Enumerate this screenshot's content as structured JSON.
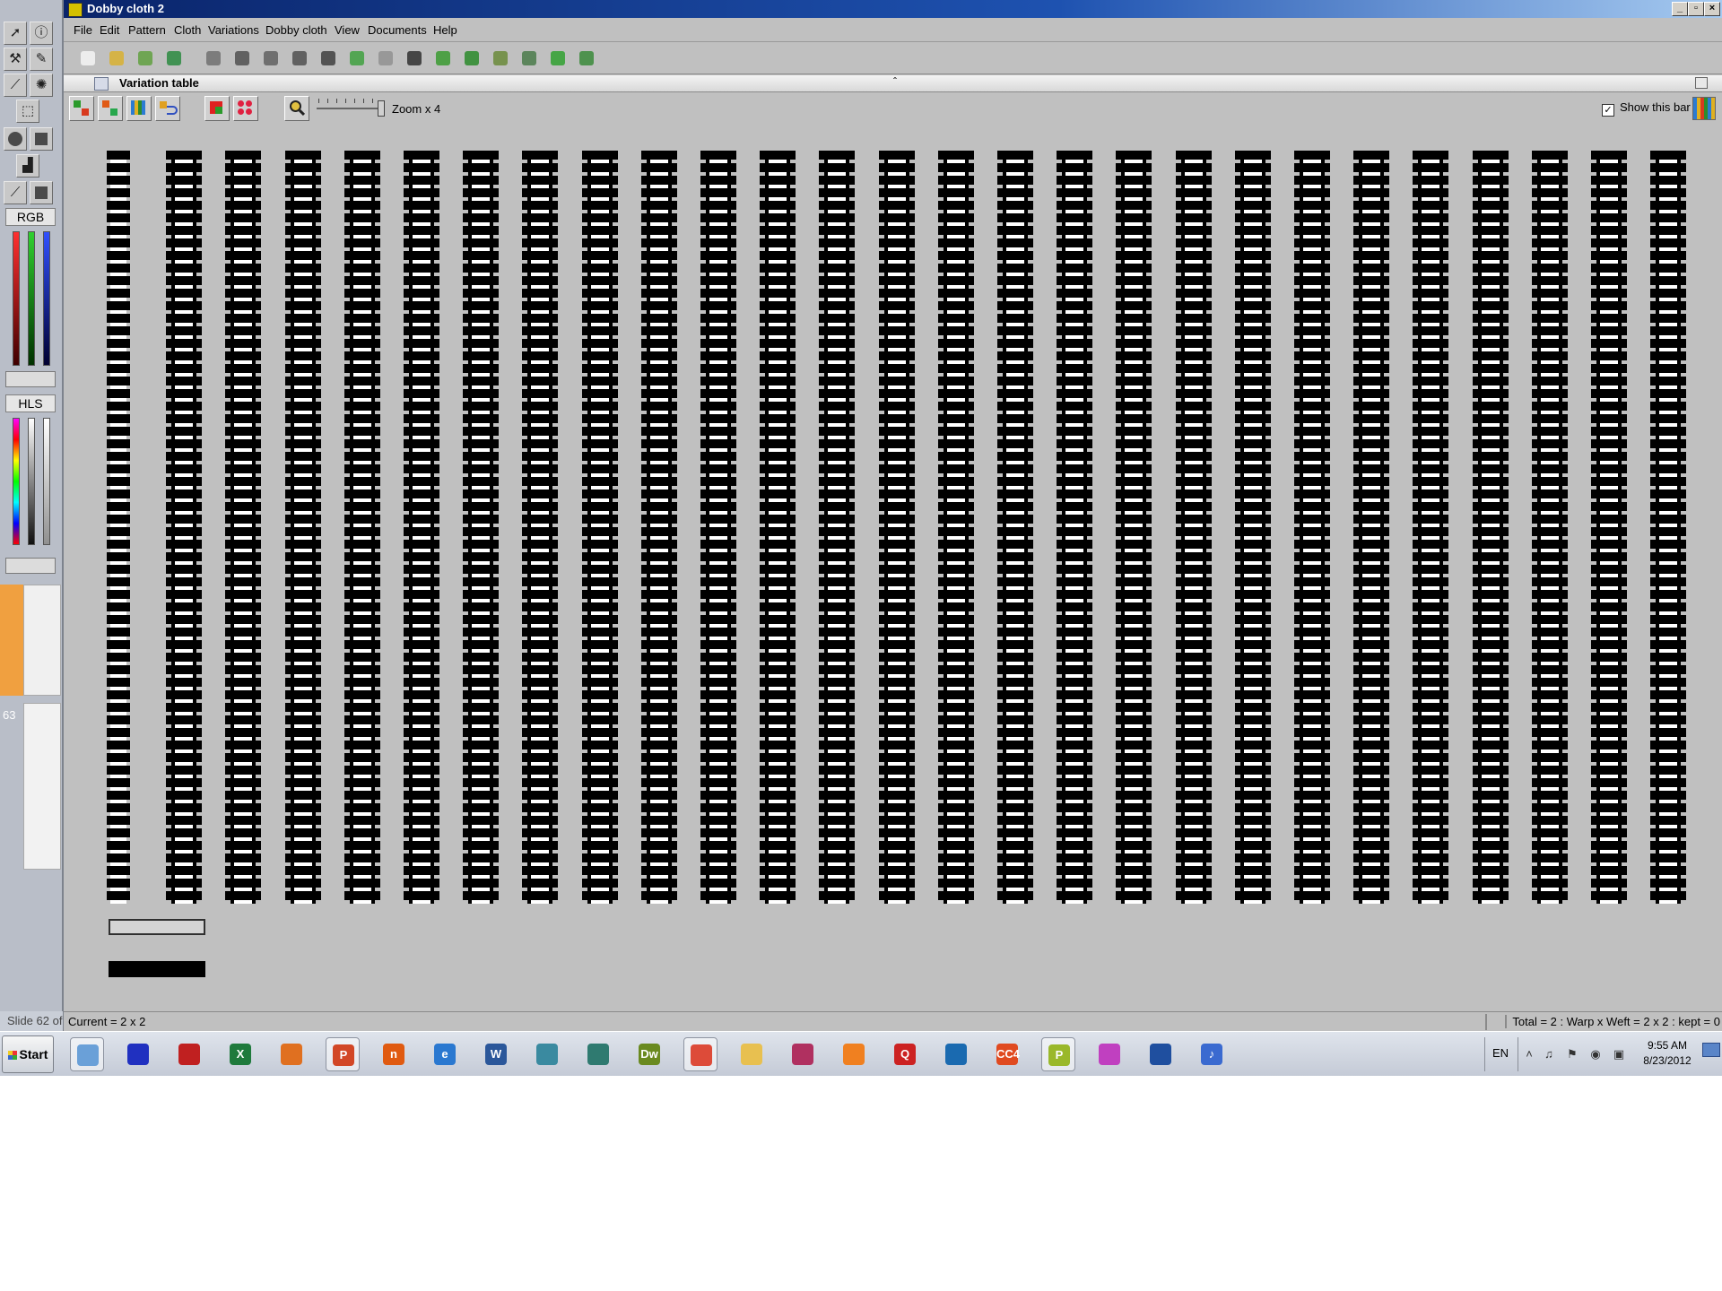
{
  "window": {
    "title": "Dobby cloth 2"
  },
  "menu": [
    "File",
    "Edit",
    "Pattern",
    "Cloth",
    "Variations",
    "Dobby cloth",
    "View",
    "Documents",
    "Help"
  ],
  "palette": {
    "rgb_label": "RGB",
    "hls_label": "HLS",
    "slide_number": "63"
  },
  "panel": {
    "title": "Variation table",
    "zoom_label": "Zoom x 4",
    "show_bar_label": "Show this bar",
    "show_bar_checked": true
  },
  "status": {
    "slide": "Slide 62 of",
    "current": "Current = 2 x 2",
    "total": "Total = 2 : Warp x Weft = 2 x 2 : kept = 0"
  },
  "taskbar": {
    "start_label": "Start",
    "language": "EN",
    "time": "9:55 AM",
    "date": "8/23/2012",
    "apps": [
      {
        "name": "explorer-app",
        "color": "#6aa0d8",
        "glyph": "",
        "active": true
      },
      {
        "name": "weave-app-1",
        "color": "#2030c0",
        "glyph": "",
        "active": false
      },
      {
        "name": "weave-app-2",
        "color": "#c02020",
        "glyph": "",
        "active": false
      },
      {
        "name": "excel-app",
        "color": "#1f7a3c",
        "glyph": "X",
        "active": false
      },
      {
        "name": "fruit-app",
        "color": "#e07020",
        "glyph": "",
        "active": false
      },
      {
        "name": "powerpoint-app",
        "color": "#d24726",
        "glyph": "P",
        "active": true
      },
      {
        "name": "office-app",
        "color": "#e05a10",
        "glyph": "n",
        "active": false
      },
      {
        "name": "ie-app",
        "color": "#2a78d0",
        "glyph": "e",
        "active": false
      },
      {
        "name": "word-app",
        "color": "#2b579a",
        "glyph": "W",
        "active": false
      },
      {
        "name": "design-app",
        "color": "#3a8aa0",
        "glyph": "",
        "active": false
      },
      {
        "name": "publisher-app",
        "color": "#2f7a70",
        "glyph": "",
        "active": false
      },
      {
        "name": "dreamweaver-app",
        "color": "#6a8a20",
        "glyph": "Dw",
        "active": false
      },
      {
        "name": "chrome-app",
        "color": "#dd4b39",
        "glyph": "",
        "active": true
      },
      {
        "name": "folder-app",
        "color": "#e8c050",
        "glyph": "",
        "active": false
      },
      {
        "name": "acrobat-app",
        "color": "#b03060",
        "glyph": "",
        "active": false
      },
      {
        "name": "media-player-app",
        "color": "#f08020",
        "glyph": "",
        "active": false
      },
      {
        "name": "quicktime-app",
        "color": "#cc2222",
        "glyph": "Q",
        "active": false
      },
      {
        "name": "textile-app",
        "color": "#1a6ab0",
        "glyph": "",
        "active": false
      },
      {
        "name": "cc4-app",
        "color": "#e04a20",
        "glyph": "CC4",
        "active": false
      },
      {
        "name": "paint-app",
        "color": "#9ab82a",
        "glyph": "P",
        "active": true
      },
      {
        "name": "pinwheel-app",
        "color": "#c040c0",
        "glyph": "",
        "active": false
      },
      {
        "name": "photo-app",
        "color": "#1f4f9f",
        "glyph": "",
        "active": false
      },
      {
        "name": "itunes-app",
        "color": "#3a6ad0",
        "glyph": "♪",
        "active": false
      }
    ]
  }
}
